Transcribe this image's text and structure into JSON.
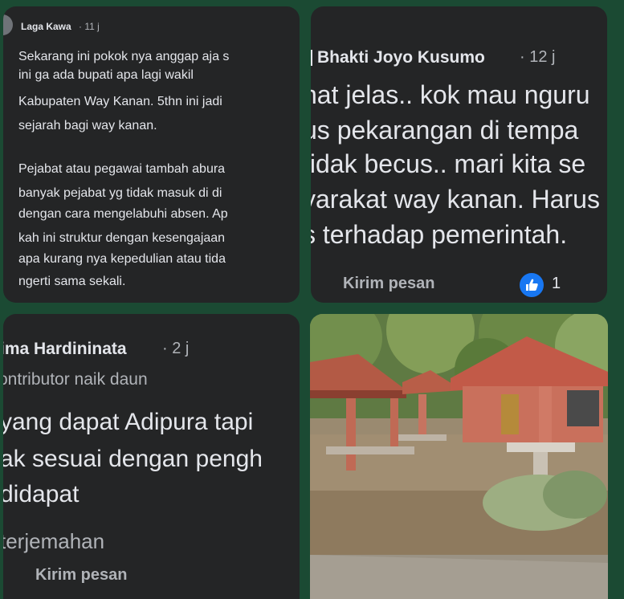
{
  "tile1": {
    "author": "Laga Kawa",
    "time": "· 11 j",
    "lines": [
      "Sekarang ini pokok nya anggap aja s",
      "ini ga ada bupati apa lagi wakil",
      "Kabupaten Way Kanan. 5thn ini jadi",
      "sejarah bagi way kanan.",
      "Pejabat atau pegawai tambah abura",
      "banyak pejabat yg tidak masuk di di",
      "dengan cara mengelabuhi absen. Ap",
      "kah ini struktur dengan kesengajaan",
      "apa kurang nya kepedulian atau tida",
      "ngerti sama sekali."
    ]
  },
  "tile2": {
    "author": "Bhakti Joyo Kusumo",
    "time": "· 12 j",
    "lines": [
      "nat jelas.. kok mau nguru",
      "us pekarangan di tempa",
      "tidak becus.. mari kita se",
      "yarakat way kanan. Harus",
      "s terhadap pemerintah."
    ],
    "send_label": "Kirim pesan",
    "like_count": "1"
  },
  "tile3": {
    "author": "ima Hardininata",
    "time": "· 2 j",
    "role": "ontributor naik daun",
    "lines": [
      "yang dapat Adipura tapi",
      "ak sesuai dengan pengh",
      "didapat"
    ],
    "translate_label": "terjemahan",
    "send_label": "Kirim pesan"
  },
  "photo": {
    "icon": "park-gazebo-photo"
  }
}
